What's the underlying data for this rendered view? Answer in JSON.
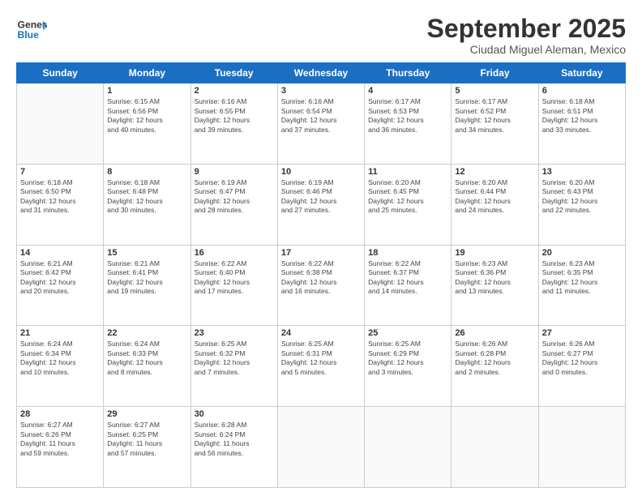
{
  "header": {
    "logo_line1": "General",
    "logo_line2": "Blue",
    "month": "September 2025",
    "location": "Ciudad Miguel Aleman, Mexico"
  },
  "weekdays": [
    "Sunday",
    "Monday",
    "Tuesday",
    "Wednesday",
    "Thursday",
    "Friday",
    "Saturday"
  ],
  "weeks": [
    [
      {
        "day": "",
        "info": ""
      },
      {
        "day": "1",
        "info": "Sunrise: 6:15 AM\nSunset: 6:56 PM\nDaylight: 12 hours\nand 40 minutes."
      },
      {
        "day": "2",
        "info": "Sunrise: 6:16 AM\nSunset: 6:55 PM\nDaylight: 12 hours\nand 39 minutes."
      },
      {
        "day": "3",
        "info": "Sunrise: 6:16 AM\nSunset: 6:54 PM\nDaylight: 12 hours\nand 37 minutes."
      },
      {
        "day": "4",
        "info": "Sunrise: 6:17 AM\nSunset: 6:53 PM\nDaylight: 12 hours\nand 36 minutes."
      },
      {
        "day": "5",
        "info": "Sunrise: 6:17 AM\nSunset: 6:52 PM\nDaylight: 12 hours\nand 34 minutes."
      },
      {
        "day": "6",
        "info": "Sunrise: 6:18 AM\nSunset: 6:51 PM\nDaylight: 12 hours\nand 33 minutes."
      }
    ],
    [
      {
        "day": "7",
        "info": "Sunrise: 6:18 AM\nSunset: 6:50 PM\nDaylight: 12 hours\nand 31 minutes."
      },
      {
        "day": "8",
        "info": "Sunrise: 6:18 AM\nSunset: 6:48 PM\nDaylight: 12 hours\nand 30 minutes."
      },
      {
        "day": "9",
        "info": "Sunrise: 6:19 AM\nSunset: 6:47 PM\nDaylight: 12 hours\nand 28 minutes."
      },
      {
        "day": "10",
        "info": "Sunrise: 6:19 AM\nSunset: 6:46 PM\nDaylight: 12 hours\nand 27 minutes."
      },
      {
        "day": "11",
        "info": "Sunrise: 6:20 AM\nSunset: 6:45 PM\nDaylight: 12 hours\nand 25 minutes."
      },
      {
        "day": "12",
        "info": "Sunrise: 6:20 AM\nSunset: 6:44 PM\nDaylight: 12 hours\nand 24 minutes."
      },
      {
        "day": "13",
        "info": "Sunrise: 6:20 AM\nSunset: 6:43 PM\nDaylight: 12 hours\nand 22 minutes."
      }
    ],
    [
      {
        "day": "14",
        "info": "Sunrise: 6:21 AM\nSunset: 6:42 PM\nDaylight: 12 hours\nand 20 minutes."
      },
      {
        "day": "15",
        "info": "Sunrise: 6:21 AM\nSunset: 6:41 PM\nDaylight: 12 hours\nand 19 minutes."
      },
      {
        "day": "16",
        "info": "Sunrise: 6:22 AM\nSunset: 6:40 PM\nDaylight: 12 hours\nand 17 minutes."
      },
      {
        "day": "17",
        "info": "Sunrise: 6:22 AM\nSunset: 6:38 PM\nDaylight: 12 hours\nand 16 minutes."
      },
      {
        "day": "18",
        "info": "Sunrise: 6:22 AM\nSunset: 6:37 PM\nDaylight: 12 hours\nand 14 minutes."
      },
      {
        "day": "19",
        "info": "Sunrise: 6:23 AM\nSunset: 6:36 PM\nDaylight: 12 hours\nand 13 minutes."
      },
      {
        "day": "20",
        "info": "Sunrise: 6:23 AM\nSunset: 6:35 PM\nDaylight: 12 hours\nand 11 minutes."
      }
    ],
    [
      {
        "day": "21",
        "info": "Sunrise: 6:24 AM\nSunset: 6:34 PM\nDaylight: 12 hours\nand 10 minutes."
      },
      {
        "day": "22",
        "info": "Sunrise: 6:24 AM\nSunset: 6:33 PM\nDaylight: 12 hours\nand 8 minutes."
      },
      {
        "day": "23",
        "info": "Sunrise: 6:25 AM\nSunset: 6:32 PM\nDaylight: 12 hours\nand 7 minutes."
      },
      {
        "day": "24",
        "info": "Sunrise: 6:25 AM\nSunset: 6:31 PM\nDaylight: 12 hours\nand 5 minutes."
      },
      {
        "day": "25",
        "info": "Sunrise: 6:25 AM\nSunset: 6:29 PM\nDaylight: 12 hours\nand 3 minutes."
      },
      {
        "day": "26",
        "info": "Sunrise: 6:26 AM\nSunset: 6:28 PM\nDaylight: 12 hours\nand 2 minutes."
      },
      {
        "day": "27",
        "info": "Sunrise: 6:26 AM\nSunset: 6:27 PM\nDaylight: 12 hours\nand 0 minutes."
      }
    ],
    [
      {
        "day": "28",
        "info": "Sunrise: 6:27 AM\nSunset: 6:26 PM\nDaylight: 11 hours\nand 59 minutes."
      },
      {
        "day": "29",
        "info": "Sunrise: 6:27 AM\nSunset: 6:25 PM\nDaylight: 11 hours\nand 57 minutes."
      },
      {
        "day": "30",
        "info": "Sunrise: 6:28 AM\nSunset: 6:24 PM\nDaylight: 11 hours\nand 56 minutes."
      },
      {
        "day": "",
        "info": ""
      },
      {
        "day": "",
        "info": ""
      },
      {
        "day": "",
        "info": ""
      },
      {
        "day": "",
        "info": ""
      }
    ]
  ]
}
